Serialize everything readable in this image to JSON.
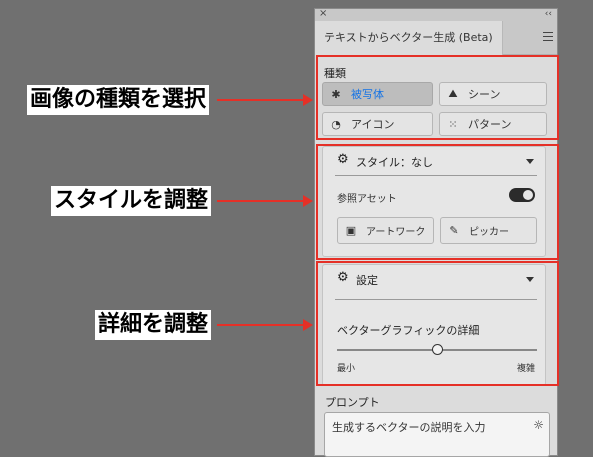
{
  "panel": {
    "close_glyph": "×",
    "collapse_glyph": "‹‹",
    "title": "テキストからベクター生成 (Beta)"
  },
  "type_section": {
    "label": "種類",
    "buttons": [
      {
        "label": "被写体",
        "icon": "subject-icon",
        "glyph": "✱",
        "selected": true
      },
      {
        "label": "シーン",
        "icon": "scene-icon",
        "glyph": "⛰"
      },
      {
        "label": "アイコン",
        "icon": "icon-type-icon",
        "glyph": "◔"
      },
      {
        "label": "パターン",
        "icon": "pattern-icon",
        "glyph": "⁙"
      }
    ]
  },
  "style_section": {
    "dropdown_label": "スタイル：なし",
    "reference_asset_label": "参照アセット",
    "toggle_on": true,
    "artwork_button": "アートワーク",
    "picker_button": "ピッカー"
  },
  "settings_section": {
    "dropdown_label": "設定",
    "detail_label": "ベクターグラフィックの詳細",
    "slider_min_label": "最小",
    "slider_max_label": "複雑",
    "slider_value": 0.5
  },
  "prompt_section": {
    "label": "プロンプト",
    "placeholder": "生成するベクターの説明を入力"
  },
  "annotations": {
    "type_select": "画像の種類を選択",
    "style_adjust": "スタイルを調整",
    "detail_adjust": "詳細を調整",
    "accent_color": "#e53027"
  },
  "colors": {
    "selected_text": "#1473e6",
    "annotation_red": "#e53027"
  }
}
